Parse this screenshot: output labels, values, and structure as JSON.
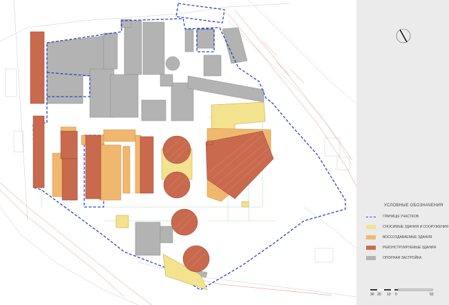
{
  "legend": {
    "title": "УСЛОВНЫЕ ОБОЗНАЧЕНИЯ",
    "items": [
      {
        "label": "ГРАНИЦЫ УЧАСТКОВ",
        "kind": "line",
        "color": "#2a3fbf"
      },
      {
        "label": "СНОСИМЫЕ ЗДАНИЯ И СООРУЖЕНИЯ",
        "kind": "fill",
        "color": "#f3e28e"
      },
      {
        "label": "ВОССОЗДАВАЕМЫЕ ЗДАНИЯ",
        "kind": "fill",
        "color": "#f0b86e"
      },
      {
        "label": "РЕКОНСТРУИРУЕМЫЕ ЗДАНИЯ",
        "kind": "fill",
        "color": "#c96a4e"
      },
      {
        "label": "ОПОРНАЯ ЗАСТРОЙКА",
        "kind": "fill",
        "color": "#b3b3b3"
      }
    ]
  },
  "scale": {
    "ticks": [
      "30",
      "20",
      "10",
      "0",
      "50"
    ]
  },
  "compass": {
    "icon": "north-arrow-icon"
  },
  "colors": {
    "demolished": "#f3e28e",
    "recreated": "#f0b86e",
    "reconstructed": "#c96a4e",
    "existing": "#b3b3b3",
    "boundary": "#2a3fbf",
    "road": "#d9534f"
  }
}
